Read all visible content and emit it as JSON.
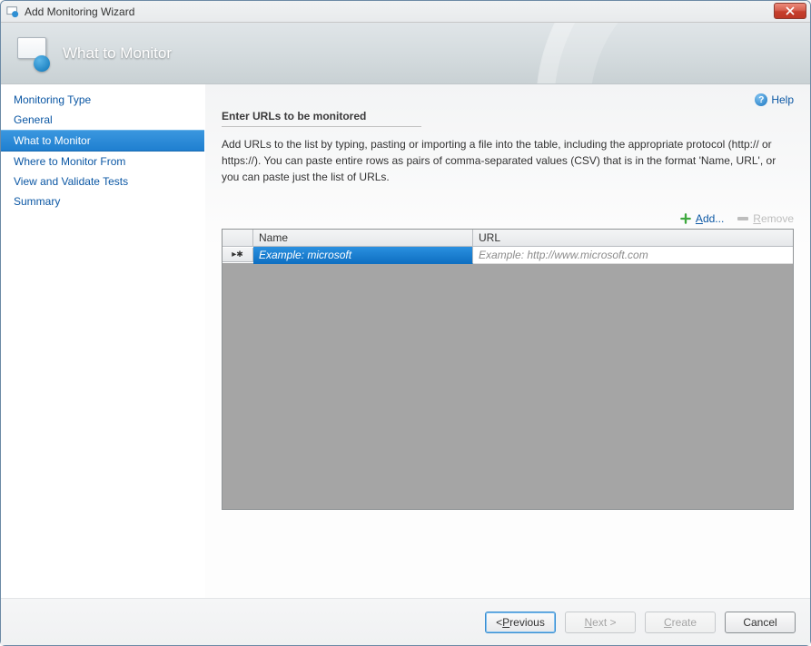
{
  "window": {
    "title": "Add Monitoring Wizard"
  },
  "header": {
    "title": "What to Monitor"
  },
  "help": {
    "label": "Help",
    "icon_glyph": "?"
  },
  "sidebar": {
    "items": [
      {
        "id": "monitoring-type",
        "label": "Monitoring Type",
        "active": false
      },
      {
        "id": "general",
        "label": "General",
        "active": false
      },
      {
        "id": "what-to-monitor",
        "label": "What to Monitor",
        "active": true
      },
      {
        "id": "where-to-monitor-from",
        "label": "Where to Monitor From",
        "active": false
      },
      {
        "id": "view-and-validate-tests",
        "label": "View and Validate Tests",
        "active": false
      },
      {
        "id": "summary",
        "label": "Summary",
        "active": false
      }
    ]
  },
  "main": {
    "section_title": "Enter URLs to be monitored",
    "description": "Add URLs to the list by typing, pasting or importing a file into the table, including the appropriate protocol (http:// or https://). You can paste entire rows as pairs of comma-separated values (CSV) that is in the format 'Name, URL', or you can paste just the list of URLs.",
    "toolbar": {
      "add": {
        "prefix": "A",
        "rest": "dd..."
      },
      "remove": {
        "prefix": "R",
        "rest": "emove",
        "enabled": false
      }
    },
    "grid": {
      "columns": {
        "name": "Name",
        "url": "URL"
      },
      "new_row_marker": "▸✱",
      "placeholder_row": {
        "name": "Example: microsoft",
        "url": "Example: http://www.microsoft.com"
      }
    }
  },
  "footer": {
    "previous": {
      "pre": "< ",
      "ul": "P",
      "post": "revious"
    },
    "next": {
      "ul": "N",
      "post": "ext >",
      "enabled": false
    },
    "create": {
      "ul": "C",
      "post": "reate",
      "enabled": false
    },
    "cancel": {
      "label": "Cancel"
    }
  }
}
